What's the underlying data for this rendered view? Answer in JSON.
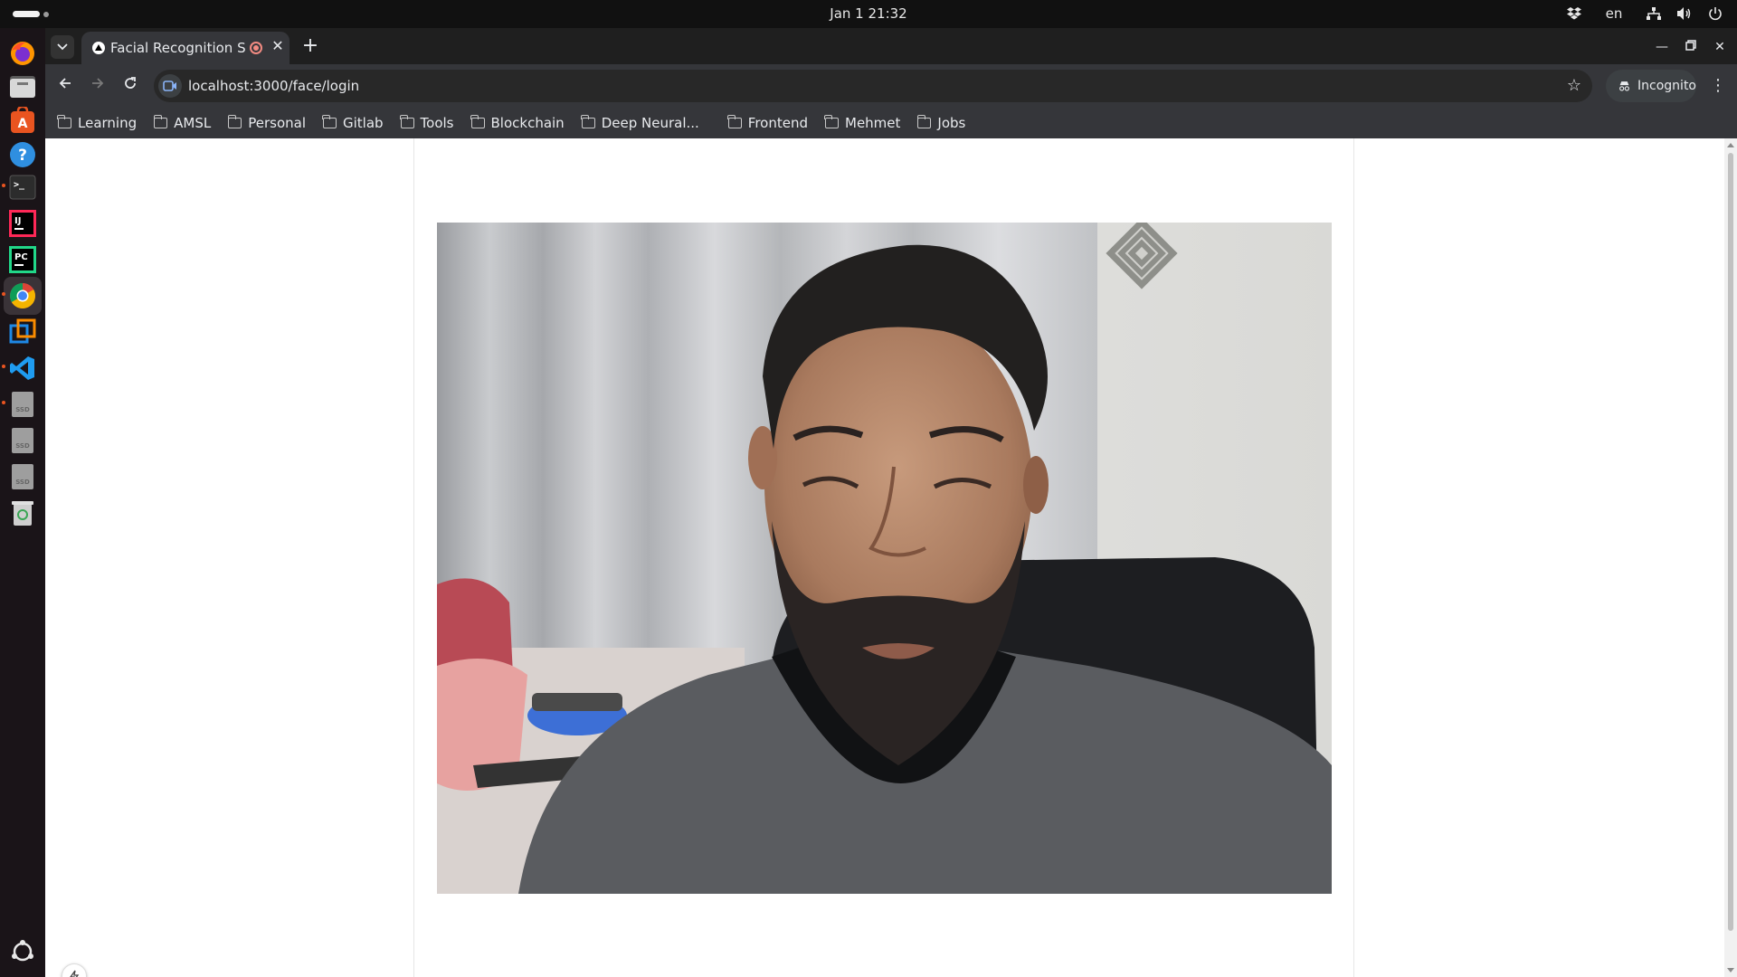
{
  "topbar": {
    "clock": "Jan 1  21:32",
    "lang": "en"
  },
  "dock": {
    "apps": [
      "firefox",
      "files",
      "software-center",
      "help",
      "terminal",
      "intellij",
      "pycharm",
      "chrome",
      "virtualbox",
      "vscode",
      "disk",
      "disk",
      "disk",
      "trash",
      "show-apps"
    ]
  },
  "browser": {
    "tab": {
      "title": "Facial Recognition Sys",
      "recording": true
    },
    "url": "localhost:3000/face/login",
    "incognito_label": "Incognito",
    "bookmarks": [
      "Learning",
      "AMSL",
      "Personal",
      "Gitlab",
      "Tools",
      "Blockchain",
      "Deep Neural...",
      "Frontend",
      "Mehmet",
      "Jobs"
    ]
  },
  "page": {
    "video_feed": "webcam"
  }
}
